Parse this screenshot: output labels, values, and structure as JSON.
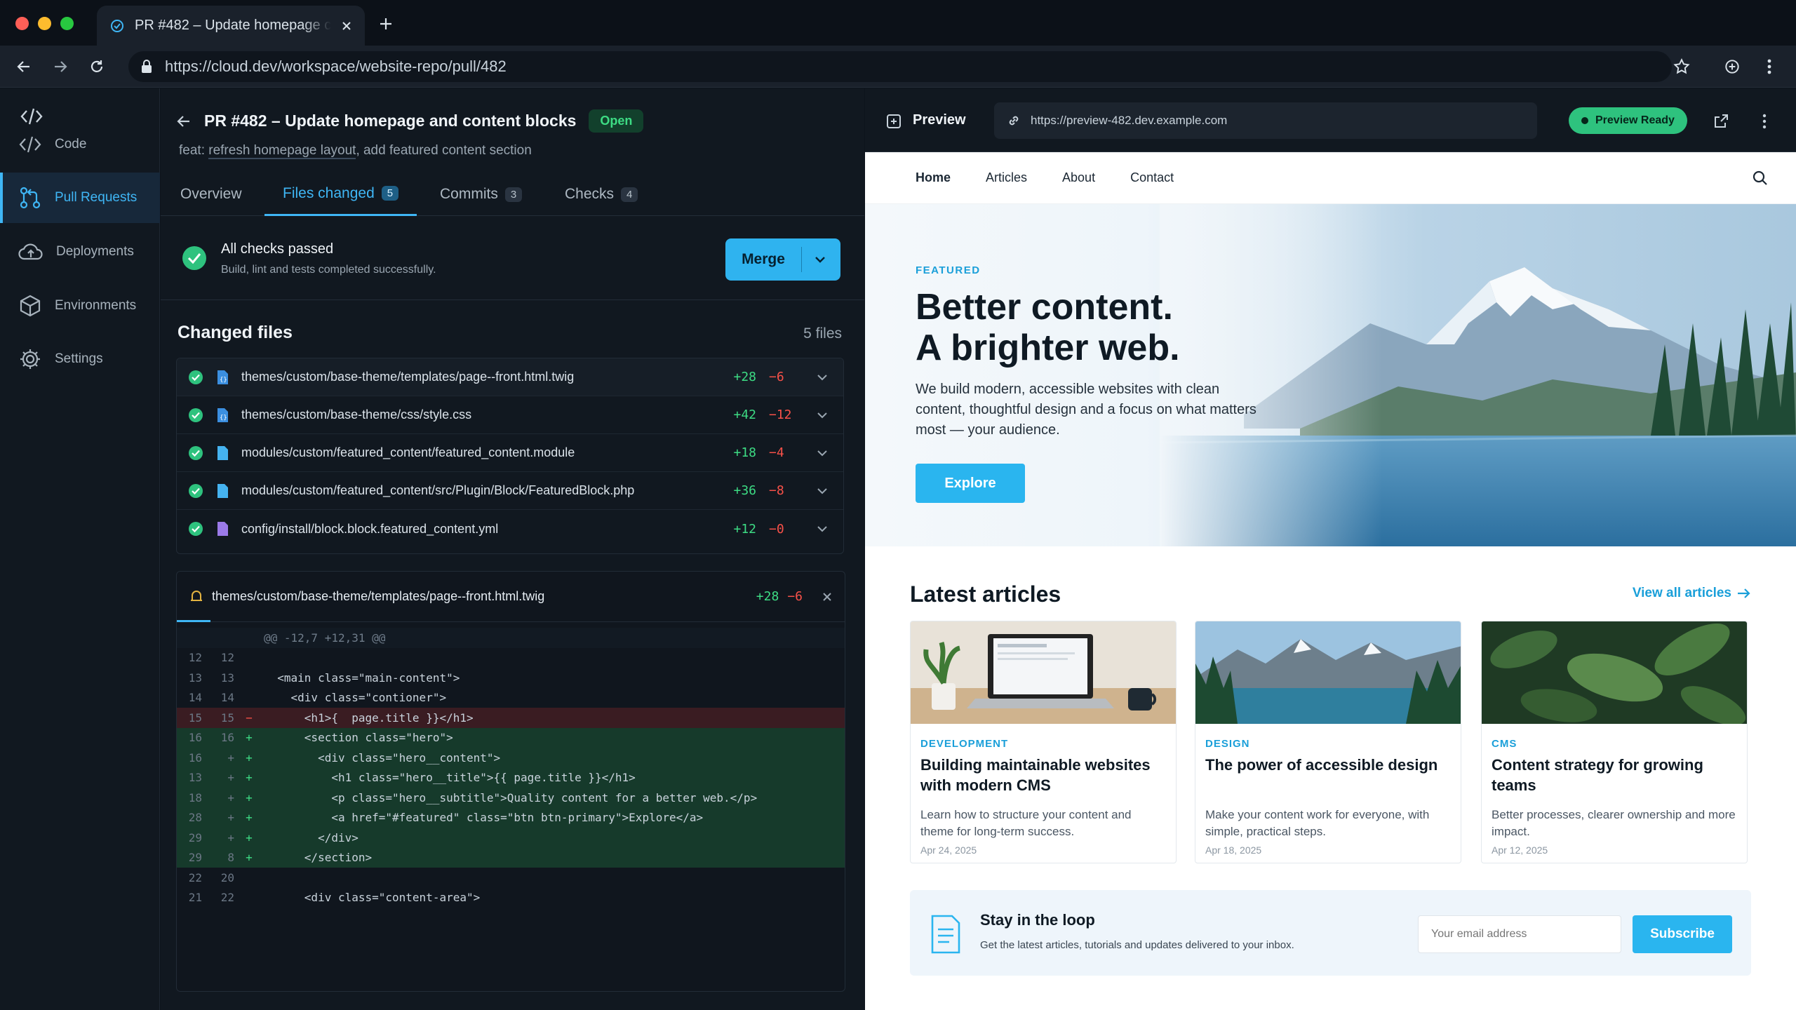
{
  "browser": {
    "tab_title": "PR #482 – Update homepage c",
    "url": "https://cloud.dev/workspace/website-repo/pull/482"
  },
  "sidebar": {
    "items": [
      {
        "label": "Code",
        "icon": "code-icon"
      },
      {
        "label": "Pull Requests",
        "icon": "pull-request-icon",
        "active": true
      },
      {
        "label": "Deployments",
        "icon": "cloud-icon"
      },
      {
        "label": "Environments",
        "icon": "box-icon"
      },
      {
        "label": "Settings",
        "icon": "gear-icon"
      }
    ]
  },
  "pr": {
    "title": "PR #482 – Update homepage and content blocks",
    "status": "Open",
    "subtitle_prefix": "feat: ",
    "subtitle_link": "refresh homepage layout",
    "subtitle_rest": ", add featured content section",
    "tabs": [
      {
        "label": "Overview",
        "count": ""
      },
      {
        "label": "Files changed",
        "count": "5",
        "active": true
      },
      {
        "label": "Commits",
        "count": "3"
      },
      {
        "label": "Checks",
        "count": "4"
      }
    ],
    "checks": {
      "title": "All checks passed",
      "detail": "Build, lint and tests completed successfully.",
      "merge_label": "Merge"
    },
    "files_heading": "Changed files",
    "files_count": "5 files",
    "files": [
      {
        "path": "themes/custom/base-theme/templates/page--front.html.twig",
        "add": "+28",
        "del": "−6",
        "icon_color": "#3b8fe0"
      },
      {
        "path": "themes/custom/base-theme/css/style.css",
        "add": "+42",
        "del": "−12",
        "icon_color": "#3b8fe0"
      },
      {
        "path": "modules/custom/featured_content/featured_content.module",
        "add": "+18",
        "del": "−4",
        "icon_color": "#45b3f0"
      },
      {
        "path": "modules/custom/featured_content/src/Plugin/Block/FeaturedBlock.php",
        "add": "+36",
        "del": "−8",
        "icon_color": "#45b3f0"
      },
      {
        "path": "config/install/block.block.featured_content.yml",
        "add": "+12",
        "del": "−0",
        "icon_color": "#9b7ae8"
      }
    ],
    "diff": {
      "file": "themes/custom/base-theme/templates/page--front.html.twig",
      "add": "+28",
      "del": "−6",
      "hunk": "@@ -12,7 +12,31 @@",
      "lines": [
        {
          "a": "12",
          "b": "12",
          "m": "",
          "type": "ctx",
          "code": ""
        },
        {
          "a": "13",
          "b": "13",
          "m": "",
          "type": "ctx",
          "code": "  <main class=\"main-content\">"
        },
        {
          "a": "14",
          "b": "14",
          "m": "",
          "type": "ctx",
          "code": "    <div class=\"contioner\">"
        },
        {
          "a": "15",
          "b": "15",
          "m": "−",
          "type": "del",
          "code": "      <h1>{  page.title }}</h1>"
        },
        {
          "a": "16",
          "b": "16",
          "m": "+",
          "type": "add",
          "code": "      <section class=\"hero\">"
        },
        {
          "a": "16",
          "b": "+",
          "m": "+",
          "type": "add",
          "code": "        <div class=\"hero__content\">"
        },
        {
          "a": "13",
          "b": "+",
          "m": "+",
          "type": "add",
          "code": "          <h1 class=\"hero__title\">{{ page.title }}</h1>"
        },
        {
          "a": "18",
          "b": "+",
          "m": "+",
          "type": "add",
          "code": "          <p class=\"hero__subtitle\">Quality content for a better web.</p>"
        },
        {
          "a": "28",
          "b": "+",
          "m": "+",
          "type": "add",
          "code": "          <a href=\"#featured\" class=\"btn btn-primary\">Explore</a>"
        },
        {
          "a": "29",
          "b": "+",
          "m": "+",
          "type": "add",
          "code": "        </div>"
        },
        {
          "a": "29",
          "b": "8",
          "m": "+",
          "type": "add",
          "code": "      </section>"
        },
        {
          "a": "22",
          "b": "20",
          "m": "",
          "type": "ctx",
          "code": ""
        },
        {
          "a": "21",
          "b": "22",
          "m": "",
          "type": "ctx",
          "code": "      <div class=\"content-area\">"
        }
      ]
    }
  },
  "preview": {
    "label": "Preview",
    "url": "https://preview-482.dev.example.com",
    "status": "Preview Ready",
    "site": {
      "nav": [
        "Home",
        "Articles",
        "About",
        "Contact"
      ],
      "hero": {
        "kicker": "FEATURED",
        "title_line1": "Better content.",
        "title_line2": "A brighter web.",
        "text": "We build modern, accessible websites with clean content, thoughtful design and a focus on what matters most — your audience.",
        "cta": "Explore"
      },
      "latest_heading": "Latest articles",
      "view_all": "View all articles",
      "cards": [
        {
          "category": "DEVELOPMENT",
          "title": "Building maintainable websites with modern CMS",
          "desc": "Learn how to structure your content and theme for long-term success.",
          "date": "Apr 24, 2025"
        },
        {
          "category": "DESIGN",
          "title": "The power of accessible design",
          "desc": "Make your content work for everyone, with simple, practical steps.",
          "date": "Apr 18, 2025"
        },
        {
          "category": "CMS",
          "title": "Content strategy for growing teams",
          "desc": "Better processes, clearer ownership and more impact.",
          "date": "Apr 12, 2025"
        }
      ],
      "newsletter": {
        "title": "Stay in the loop",
        "desc": "Get the latest articles, tutorials and updates delivered to your inbox.",
        "placeholder": "Your email address",
        "button": "Subscribe"
      }
    }
  },
  "colors": {
    "accent": "#3fb6f5",
    "success": "#3ddc84",
    "danger": "#f85149",
    "sidebar_bg": "#111820"
  }
}
